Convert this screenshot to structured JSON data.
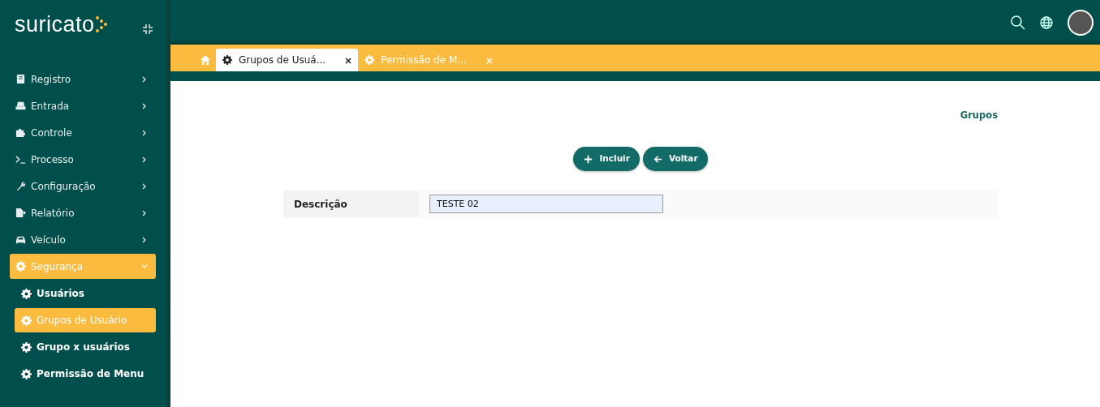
{
  "logo": {
    "text": "suricato"
  },
  "menu": [
    {
      "label": "Registro",
      "kind": "book",
      "expanded": false
    },
    {
      "label": "Entrada",
      "kind": "tray",
      "expanded": false
    },
    {
      "label": "Controle",
      "kind": "puzzle",
      "expanded": false
    },
    {
      "label": "Processo",
      "kind": "terminal",
      "expanded": false
    },
    {
      "label": "Configuração",
      "kind": "wrench",
      "expanded": false
    },
    {
      "label": "Relatório",
      "kind": "file",
      "expanded": false
    },
    {
      "label": "Veículo",
      "kind": "car",
      "expanded": false
    },
    {
      "label": "Segurança",
      "kind": "gear",
      "expanded": true,
      "children": [
        {
          "label": "Usuários",
          "selected": false
        },
        {
          "label": "Grupos de Usuário",
          "selected": true
        },
        {
          "label": "Grupo x usuários",
          "selected": false
        },
        {
          "label": "Permissão de Menu",
          "selected": false
        }
      ]
    }
  ],
  "tabs": [
    {
      "label": "Grupos de Usuá...",
      "selected": true
    },
    {
      "label": "Permissão de M...",
      "selected": false
    }
  ],
  "page": {
    "title": "Grupos",
    "buttons": [
      {
        "label": "Incluir",
        "kind": "add"
      },
      {
        "label": "Voltar",
        "kind": "back"
      }
    ],
    "fields": [
      {
        "label": "Descrição",
        "value": "TESTE 02"
      }
    ]
  }
}
